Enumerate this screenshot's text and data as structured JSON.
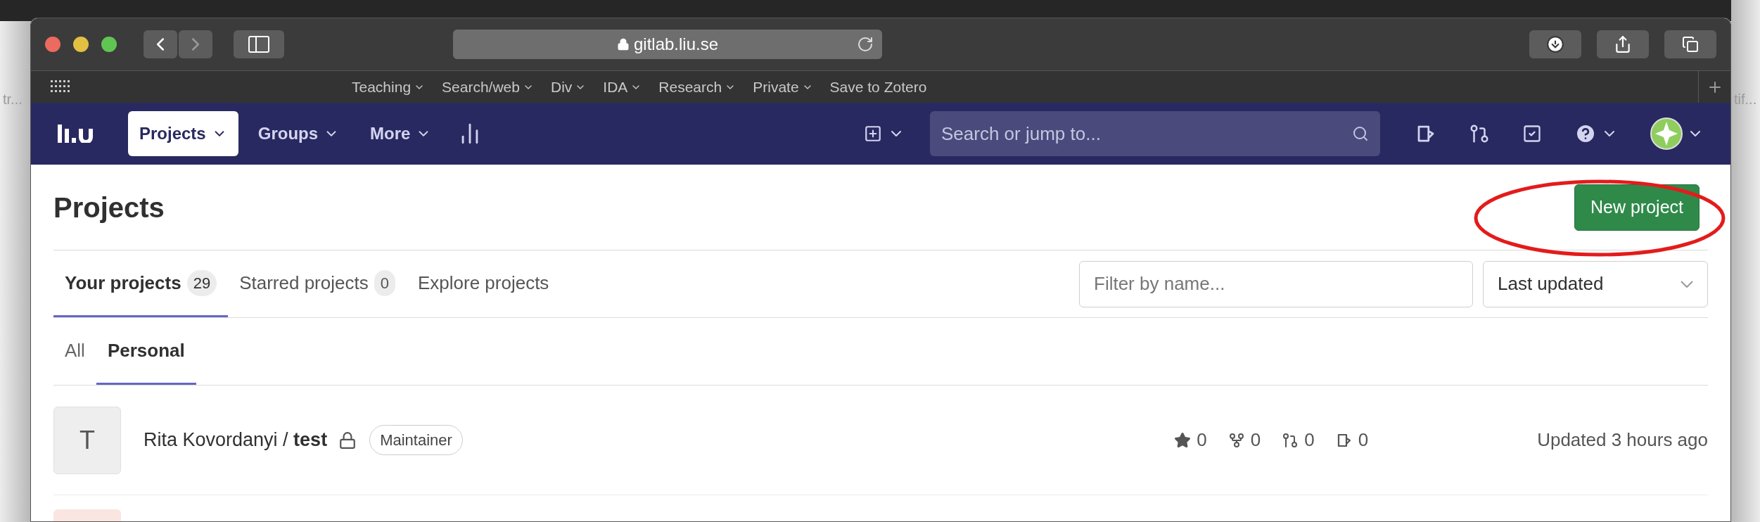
{
  "background_tabs": {
    "left": "tr...",
    "right": "tif..."
  },
  "browser": {
    "address": "gitlab.liu.se",
    "bookmarks": [
      "Teaching",
      "Search/web",
      "Div",
      "IDA",
      "Research",
      "Private"
    ],
    "bookmark_link": "Save to Zotero"
  },
  "navbar": {
    "items": [
      {
        "label": "Projects",
        "selected": true
      },
      {
        "label": "Groups",
        "selected": false
      },
      {
        "label": "More",
        "selected": false
      }
    ],
    "search": {
      "placeholder": "Search or jump to..."
    }
  },
  "page": {
    "title": "Projects",
    "new_button": "New project",
    "tabs": [
      {
        "label": "Your projects",
        "count": "29",
        "selected": true
      },
      {
        "label": "Starred projects",
        "count": "0",
        "selected": false
      },
      {
        "label": "Explore projects",
        "selected": false
      }
    ],
    "filter": {
      "placeholder": "Filter by name..."
    },
    "sort": "Last updated",
    "subtabs": [
      {
        "label": "All",
        "selected": false
      },
      {
        "label": "Personal",
        "selected": true
      }
    ],
    "projects": [
      {
        "avatar": "T",
        "namespace": "Rita Kovordanyi / ",
        "name": "test",
        "private": true,
        "role": "Maintainer",
        "stars": "0",
        "forks": "0",
        "merge_requests": "0",
        "issues": "0",
        "updated": "Updated 3 hours ago"
      }
    ]
  }
}
